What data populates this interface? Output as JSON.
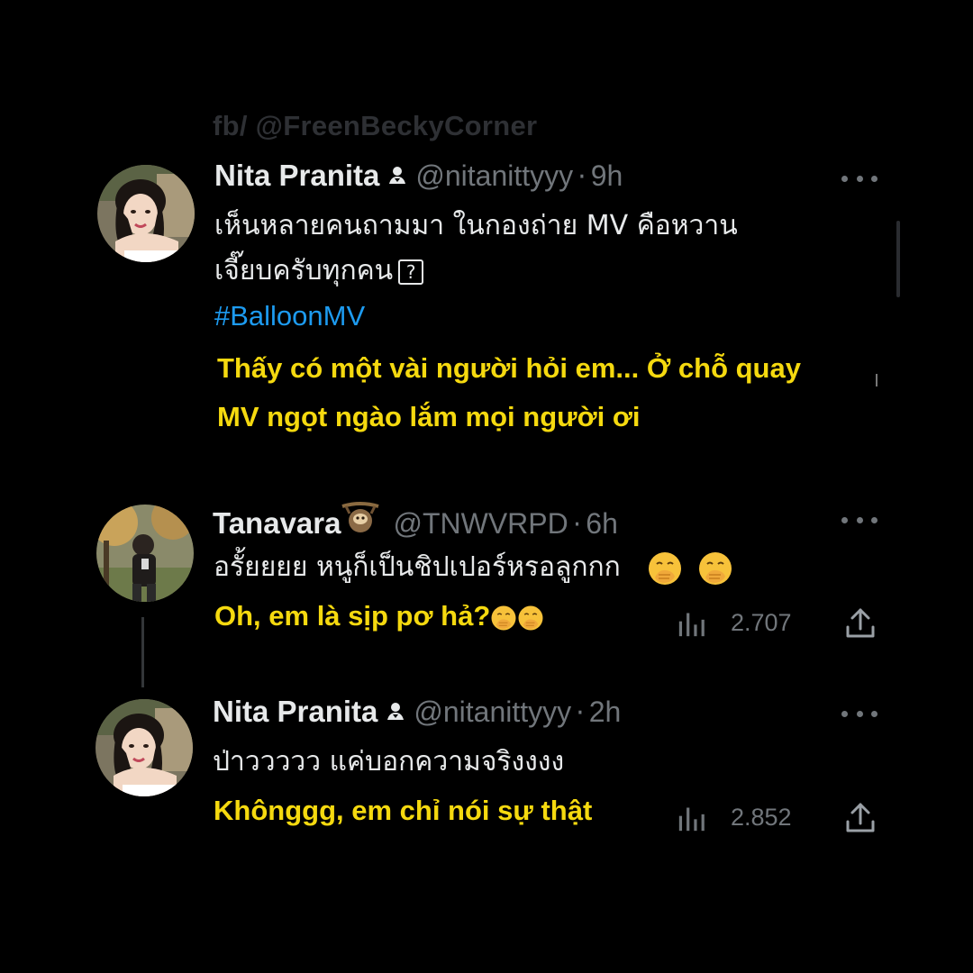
{
  "watermark": "fb/ @FreenBeckyCorner",
  "tweets": [
    {
      "name": "Nita Pranita",
      "handle": "@nitanittyyy",
      "separator": "·",
      "time": "9h",
      "text_line1": "เห็นหลายคนถามมา ในกองถ่าย MV คือหวาน",
      "text_line2": "เจี๊ยบครับทุกคน",
      "unknown_glyph": "?",
      "hashtag": "#BalloonMV",
      "translation_line1": "Thấy có một vài người hỏi em... Ở chỗ quay",
      "translation_line2": "MV ngọt ngào lắm mọi người ơi"
    },
    {
      "name": "Tanavara",
      "handle": "@TNWVRPD",
      "separator": "·",
      "time": "6h",
      "text": "อรั้ยยยย หนูก็เป็นชิปเปอร์หรอลูกกก",
      "translation": "Oh, em là sịp pơ hả?",
      "views": "2.707"
    },
    {
      "name": "Nita Pranita",
      "handle": "@nitanittyyy",
      "separator": "·",
      "time": "2h",
      "text": "ป่าววววว แค่บอกความจริงงงง",
      "translation": "Khônggg, em chỉ nói sự thật",
      "views": "2.852"
    }
  ],
  "icons": {
    "more": "more-horizontal-icon",
    "views": "bar-chart-icon",
    "share": "share-icon",
    "badge": "person-badge-icon",
    "emoji": "face-with-hand-over-mouth-emoji",
    "sloth": "sloth-emoji"
  },
  "colors": {
    "background": "#000000",
    "text": "#e7e9ea",
    "muted": "#71767b",
    "hashtag": "#1d9bf0",
    "translation": "#f5d90f"
  }
}
